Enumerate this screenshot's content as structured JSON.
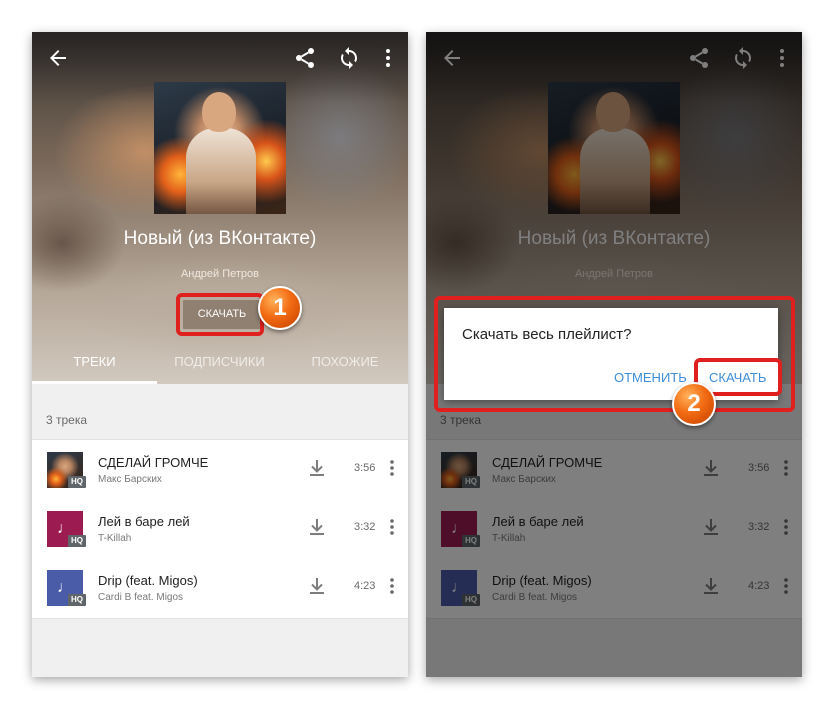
{
  "header": {
    "title": "Новый (из ВКонтакте)",
    "author": "Андрей Петров",
    "download_button": "СКАЧАТЬ"
  },
  "tabs": [
    "ТРЕКИ",
    "ПОДПИСЧИКИ",
    "ПОХОЖИЕ"
  ],
  "track_count": "3 трека",
  "tracks": [
    {
      "name": "СДЕЛАЙ ГРОМЧЕ",
      "artist": "Макс Барских",
      "duration": "3:56",
      "badge": "HQ",
      "thumb": "photo"
    },
    {
      "name": "Лей в баре лей",
      "artist": "T-Killah",
      "duration": "3:32",
      "badge": "HQ",
      "thumb": "note",
      "thumb_color": "#9c1c52"
    },
    {
      "name": "Drip (feat. Migos)",
      "artist": "Cardi B feat. Migos",
      "duration": "4:23",
      "badge": "HQ",
      "thumb": "note",
      "thumb_color": "#4a5ba8"
    }
  ],
  "dialog": {
    "question": "Скачать весь плейлист?",
    "cancel": "ОТМЕНИТЬ",
    "confirm": "СКАЧАТЬ"
  },
  "markers": [
    "1",
    "2"
  ],
  "colors": {
    "highlight": "#e0201f",
    "accent": "#3d8ed8",
    "marker": "#f26a12"
  },
  "icons": [
    "back-arrow-icon",
    "share-icon",
    "sync-icon",
    "more-vert-icon",
    "download-icon",
    "music-note-icon"
  ]
}
